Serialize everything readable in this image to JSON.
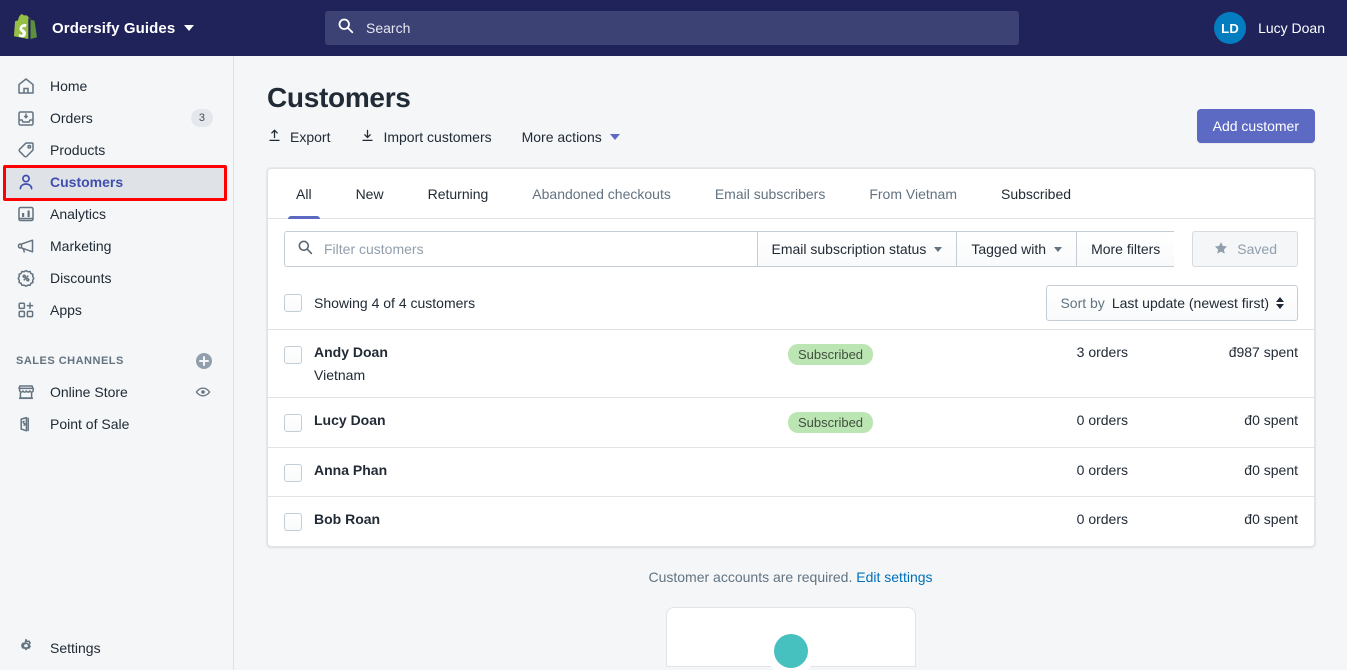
{
  "topbar": {
    "brand_name": "Ordersify Guides",
    "logo_icon": "shopify-bag-icon",
    "caret_icon": "chevron-down-icon",
    "search": {
      "icon": "search-icon",
      "placeholder": "Search",
      "value": ""
    },
    "user": {
      "initials": "LD",
      "name": "Lucy Doan"
    },
    "bg_color": "#1f2359",
    "search_bg": "#3d4274",
    "avatar_color": "#047cc0"
  },
  "sidebar": {
    "items": [
      {
        "label": "Home",
        "icon": "home-icon",
        "badge": "",
        "active": false
      },
      {
        "label": "Orders",
        "icon": "orders-inbox-icon",
        "badge": "3",
        "active": false
      },
      {
        "label": "Products",
        "icon": "product-tag-icon",
        "badge": "",
        "active": false
      },
      {
        "label": "Customers",
        "icon": "person-icon",
        "badge": "",
        "active": true
      },
      {
        "label": "Analytics",
        "icon": "bar-chart-icon",
        "badge": "",
        "active": false
      },
      {
        "label": "Marketing",
        "icon": "megaphone-icon",
        "badge": "",
        "active": false
      },
      {
        "label": "Discounts",
        "icon": "discount-percent-icon",
        "badge": "",
        "active": false
      },
      {
        "label": "Apps",
        "icon": "apps-grid-plus-icon",
        "badge": "",
        "active": false
      }
    ],
    "section_title": "SALES CHANNELS",
    "add_channel_icon": "circle-plus-icon",
    "channels": [
      {
        "label": "Online Store",
        "icon": "storefront-icon",
        "trailing_icon": "eye-icon"
      },
      {
        "label": "Point of Sale",
        "icon": "pos-bag-icon",
        "trailing_icon": ""
      }
    ],
    "settings": {
      "label": "Settings",
      "icon": "gear-icon"
    },
    "active_highlight_color": "#ff0000"
  },
  "page": {
    "title": "Customers",
    "actions": [
      {
        "label": "Export",
        "icon": "export-up-arrow-icon"
      },
      {
        "label": "Import customers",
        "icon": "import-down-arrow-icon"
      },
      {
        "label": "More actions",
        "icon": "chevron-down-icon"
      }
    ],
    "primary_button": {
      "label": "Add customer",
      "color": "#5c6ac4"
    }
  },
  "tabs": [
    {
      "label": "All",
      "selected": true,
      "dim": false
    },
    {
      "label": "New",
      "selected": false,
      "dim": false
    },
    {
      "label": "Returning",
      "selected": false,
      "dim": false
    },
    {
      "label": "Abandoned checkouts",
      "selected": false,
      "dim": true
    },
    {
      "label": "Email subscribers",
      "selected": false,
      "dim": true
    },
    {
      "label": "From Vietnam",
      "selected": false,
      "dim": true
    },
    {
      "label": "Subscribed",
      "selected": false,
      "dim": false
    }
  ],
  "filters": {
    "search": {
      "icon": "search-icon",
      "placeholder": "Filter customers",
      "value": ""
    },
    "buttons": [
      {
        "label": "Email subscription status",
        "has_caret": true
      },
      {
        "label": "Tagged with",
        "has_caret": true
      },
      {
        "label": "More filters",
        "has_caret": false
      }
    ],
    "saved": {
      "label": "Saved",
      "icon": "star-icon",
      "disabled": true
    }
  },
  "list_header": {
    "showing_text": "Showing 4 of 4 customers",
    "sort": {
      "prefix": "Sort by",
      "value": "Last update (newest first)",
      "icon": "up-down-arrows-icon"
    }
  },
  "customers": [
    {
      "name": "Andy Doan",
      "location": "Vietnam",
      "badge": "Subscribed",
      "orders": "3 orders",
      "spent": "đ987 spent"
    },
    {
      "name": "Lucy Doan",
      "location": "",
      "badge": "Subscribed",
      "orders": "0 orders",
      "spent": "đ0 spent"
    },
    {
      "name": "Anna Phan",
      "location": "",
      "badge": "",
      "orders": "0 orders",
      "spent": "đ0 spent"
    },
    {
      "name": "Bob Roan",
      "location": "",
      "badge": "",
      "orders": "0 orders",
      "spent": "đ0 spent"
    }
  ],
  "footer": {
    "note": "Customer accounts are required.",
    "link": "Edit settings"
  }
}
